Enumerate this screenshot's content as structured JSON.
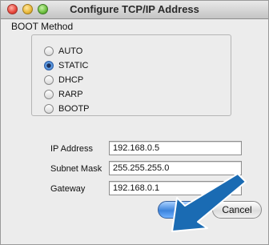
{
  "window": {
    "title": "Configure TCP/IP Address"
  },
  "boot_method": {
    "label": "BOOT Method",
    "options": [
      {
        "label": "AUTO",
        "selected": false
      },
      {
        "label": "STATIC",
        "selected": true
      },
      {
        "label": "DHCP",
        "selected": false
      },
      {
        "label": "RARP",
        "selected": false
      },
      {
        "label": "BOOTP",
        "selected": false
      }
    ]
  },
  "fields": [
    {
      "label": "IP Address",
      "value": "192.168.0.5"
    },
    {
      "label": "Subnet Mask",
      "value": "255.255.255.0"
    },
    {
      "label": "Gateway",
      "value": "192.168.0.1"
    }
  ],
  "buttons": {
    "ok": "OK",
    "cancel": "Cancel"
  },
  "colors": {
    "arrow": "#1a6bb3",
    "ok_button": "#3c83dc"
  },
  "annotation": {
    "arrow_icon": "pointer-arrow-icon"
  }
}
